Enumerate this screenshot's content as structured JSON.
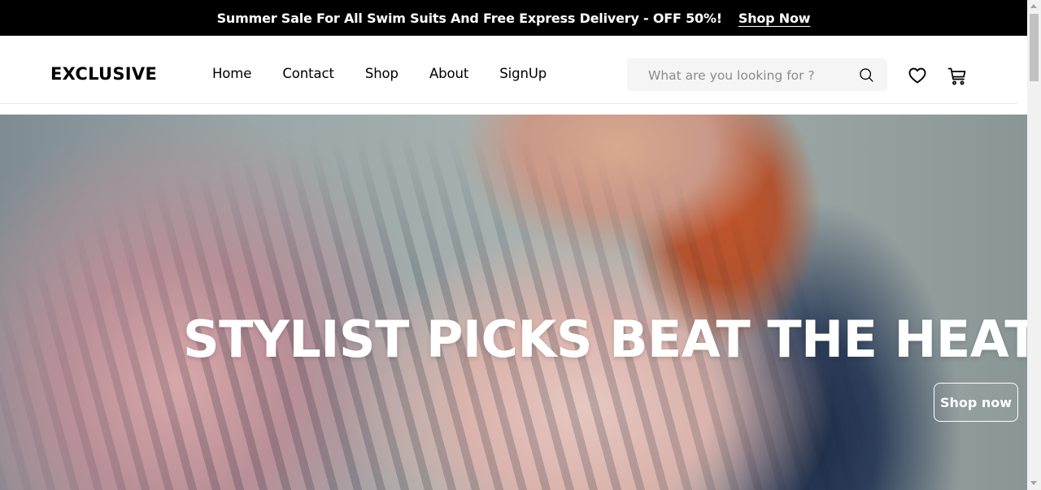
{
  "topbar": {
    "promo_text": "Summer Sale For All Swim Suits And Free Express Delivery - OFF 50%!",
    "shop_link": "Shop Now"
  },
  "header": {
    "logo": "EXCLUSIVE",
    "nav": [
      "Home",
      "Contact",
      "Shop",
      "About",
      "SignUp"
    ],
    "search_placeholder": "What are you looking for ?",
    "icons": [
      "search-icon",
      "heart-icon",
      "cart-icon"
    ]
  },
  "hero": {
    "title": "STYLIST PICKS BEAT THE HEAT",
    "button": "Shop now"
  },
  "colors": {
    "topbar_bg": "#000000",
    "search_bg": "#F5F5F5",
    "text": "#000000",
    "hero_text": "#FFFFFF"
  }
}
